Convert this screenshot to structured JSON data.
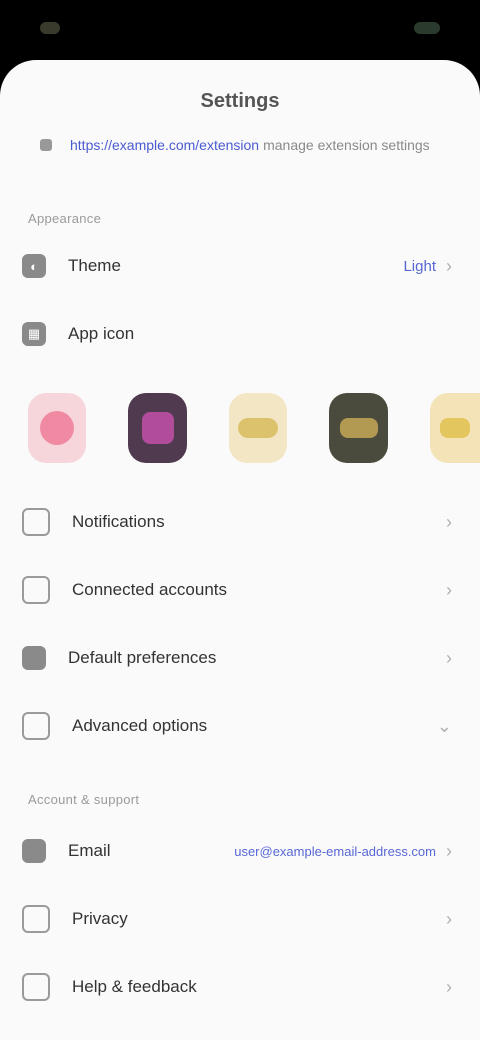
{
  "statusbar": {},
  "header": {
    "title": "Settings",
    "url_link": "https://example.com/extension",
    "url_rest": "manage extension settings"
  },
  "section1": {
    "label": "Appearance",
    "theme_label": "Theme",
    "theme_value": "Light",
    "app_icon_label": "App icon"
  },
  "section1_rows": [
    {
      "label": "Notifications",
      "icon": "bell-icon"
    },
    {
      "label": "Connected accounts",
      "icon": "link-icon"
    },
    {
      "label": "Default preferences",
      "icon": "sliders-icon"
    },
    {
      "label": "Advanced options",
      "icon": "gear-icon"
    }
  ],
  "section2": {
    "label": "Account & support",
    "rows": [
      {
        "label": "Email",
        "value": "user@example-email-address.com",
        "icon": "mail-icon"
      },
      {
        "label": "Privacy",
        "icon": "lock-icon"
      },
      {
        "label": "Help & feedback",
        "icon": "help-icon"
      }
    ]
  },
  "colors": {
    "accent": "#4a5bd0",
    "background": "#fafafa"
  }
}
